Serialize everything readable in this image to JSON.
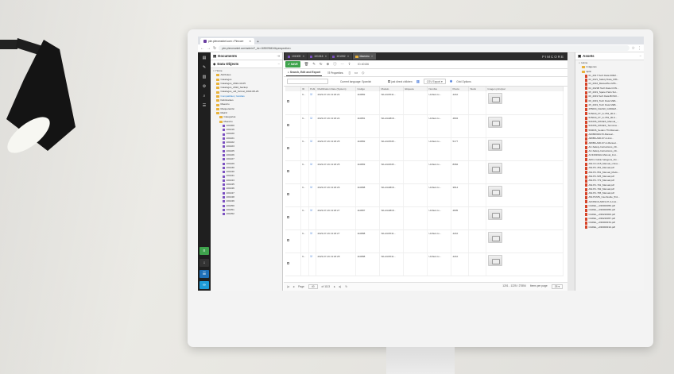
{
  "browser": {
    "tab_title": "pim.pieromarket.com • Pimcore",
    "new_tab": "+",
    "url": "pim.pieromarket.com/admin/?_dc=1690098434&perspective="
  },
  "left_sidebar": {
    "buttons_bottom": [
      "≡",
      "↓",
      "☰",
      "∞"
    ]
  },
  "tree": {
    "documents_label": "Documents",
    "data_objects_label": "Data Objects",
    "rows": [
      {
        "label": "Home",
        "type": "home",
        "level": 0
      },
      {
        "label": "Attributes",
        "type": "folder",
        "level": 1
      },
      {
        "label": "Catalogos",
        "type": "folder",
        "level": 1
      },
      {
        "label": "Catalogos_2022-10-05",
        "type": "folder",
        "level": 1
      },
      {
        "label": "Catalogos_2022_backup",
        "type": "folder",
        "level": 1
      },
      {
        "label": "Catalogos_old_format_2022-08-26",
        "type": "folder",
        "level": 1
      },
      {
        "label": "Compatibles | familias",
        "type": "folder",
        "level": 1,
        "selected": true
      },
      {
        "label": "Fabricantes",
        "type": "folder",
        "level": 1
      },
      {
        "label": "Maestro",
        "type": "folder",
        "level": 1
      },
      {
        "label": "Maquetación",
        "type": "folder",
        "level": 1
      },
      {
        "label": "Matriz",
        "type": "folder",
        "level": 1
      },
      {
        "label": "Categorias",
        "type": "folder",
        "level": 2
      },
      {
        "label": "Maestro",
        "type": "folder",
        "level": 2
      },
      {
        "label": "101000",
        "type": "object",
        "level": 3
      },
      {
        "label": "101016",
        "type": "object",
        "level": 3
      },
      {
        "label": "101020",
        "type": "object",
        "level": 3
      },
      {
        "label": "101021",
        "type": "object",
        "level": 3
      },
      {
        "label": "101022",
        "type": "object",
        "level": 3
      },
      {
        "label": "101023",
        "type": "object",
        "level": 3
      },
      {
        "label": "101025",
        "type": "object",
        "level": 3
      },
      {
        "label": "101026",
        "type": "object",
        "level": 3
      },
      {
        "label": "101027",
        "type": "object",
        "level": 3
      },
      {
        "label": "101029",
        "type": "object",
        "level": 3
      },
      {
        "label": "101030",
        "type": "object",
        "level": 3
      },
      {
        "label": "101040",
        "type": "object",
        "level": 3
      },
      {
        "label": "101041",
        "type": "object",
        "level": 3
      },
      {
        "label": "101043",
        "type": "object",
        "level": 3
      },
      {
        "label": "101045",
        "type": "object",
        "level": 3
      },
      {
        "label": "101046",
        "type": "object",
        "level": 3
      },
      {
        "label": "101047",
        "type": "object",
        "level": 3
      },
      {
        "label": "101048",
        "type": "object",
        "level": 3
      },
      {
        "label": "101049",
        "type": "object",
        "level": 3
      },
      {
        "label": "101050",
        "type": "object",
        "level": 3
      },
      {
        "label": "101051",
        "type": "object",
        "level": 3
      },
      {
        "label": "101052",
        "type": "object",
        "level": 3
      }
    ]
  },
  "editor": {
    "tabs": [
      {
        "label": "101009",
        "active": false
      },
      {
        "label": "101016",
        "active": false
      },
      {
        "label": "101052",
        "active": false
      },
      {
        "label": "Maestro",
        "active": true
      }
    ],
    "brand": "PIMCORE",
    "save_label": "SAVE",
    "id_label": "ID 40136",
    "subtabs": [
      "Search, Edit and Export",
      "Properties"
    ],
    "search_placeholder": "",
    "language_label": "Current language: Spanish",
    "only_children_label": "just direct children",
    "csv_export_label": "CSV Export",
    "grid_options_label": "Grid Options",
    "columns": [
      "ID",
      "Publ.",
      "Modification Date (System)",
      "Codigo",
      "Modelo",
      "Etiqueta",
      "Nombre",
      "Precio",
      "Stock",
      "Imagen principal"
    ],
    "rows": [
      {
        "id": "9...",
        "publ": true,
        "date": "2023-07-19 13:18:24",
        "codigo": "110882",
        "modelo": "SILAIA5X11...",
        "etiqueta": "",
        "nombre": "Unified co...",
        "precio": "4210",
        "stock": ""
      },
      {
        "id": "9...",
        "publ": true,
        "date": "2023-07-19 13:18:24",
        "codigo": "110881",
        "modelo": "SILAIA4818...",
        "etiqueta": "",
        "nombre": "Unified co...",
        "precio": "4834",
        "stock": ""
      },
      {
        "id": "9...",
        "publ": true,
        "date": "2023-07-19 13:18:25",
        "codigo": "110882",
        "modelo": "SILAIA5X25...",
        "etiqueta": "",
        "nombre": "Unified co...",
        "precio": "5177",
        "stock": ""
      },
      {
        "id": "9...",
        "publ": true,
        "date": "2023-07-19 13:18:25",
        "codigo": "110883",
        "modelo": "SILAIA6X25...",
        "etiqueta": "",
        "nombre": "Unified co...",
        "precio": "8084",
        "stock": ""
      },
      {
        "id": "9...",
        "publ": true,
        "date": "2023-07-19 13:18:26",
        "codigo": "110888",
        "modelo": "SILAIA4818...",
        "etiqueta": "",
        "nombre": "Unified co...",
        "precio": "3814",
        "stock": ""
      },
      {
        "id": "9...",
        "publ": true,
        "date": "2023-07-19 13:18:27",
        "codigo": "110887",
        "modelo": "SILAIA4818...",
        "etiqueta": "",
        "nombre": "Unified co...",
        "precio": "4835",
        "stock": ""
      },
      {
        "id": "9...",
        "publ": true,
        "date": "2023-07-19 13:18:27",
        "codigo": "110888",
        "modelo": "SILAIA5X11...",
        "etiqueta": "",
        "nombre": "Unified co...",
        "precio": "4210",
        "stock": ""
      },
      {
        "id": "9...",
        "publ": true,
        "date": "2023-07-19 13:18:28",
        "codigo": "110888",
        "modelo": "SILAIA5X11...",
        "etiqueta": "",
        "nombre": "Unified co...",
        "precio": "4210",
        "stock": ""
      }
    ],
    "pager": {
      "page_label": "Page",
      "page_value": "40",
      "of_label": "of 1113",
      "range": "1201 - 1225 / 27854",
      "items_label": "Items per page",
      "items_value": "25"
    }
  },
  "assets": {
    "title": "Assets",
    "rows": [
      {
        "label": "Home",
        "type": "home",
        "level": 0
      },
      {
        "label": "Imágenes",
        "type": "folder",
        "level": 1
      },
      {
        "label": "Aplic",
        "type": "folder",
        "level": 1
      },
      {
        "label": "01_2017 Tech Data 003M...",
        "type": "pdf",
        "level": 2
      },
      {
        "label": "02_2021_Safety Data_MIS...",
        "type": "pdf",
        "level": 2
      },
      {
        "label": "03_2016_ManualTec-MIS...",
        "type": "pdf",
        "level": 2
      },
      {
        "label": "04_2021B Tech Data CON...",
        "type": "pdf",
        "level": 2
      },
      {
        "label": "05_2019_Spare Parts SH...",
        "type": "pdf",
        "level": 2
      },
      {
        "label": "06_2019 Tech Data BOSO...",
        "type": "pdf",
        "level": 2
      },
      {
        "label": "09_2019_Tech Data ME6...",
        "type": "pdf",
        "level": 2
      },
      {
        "label": "25_2019_Tech Data ME8...",
        "type": "pdf",
        "level": 2
      },
      {
        "label": "255004_FHAS0_GODEM...",
        "type": "pdf",
        "level": 2
      },
      {
        "label": "515044_FT_G-V53_00-0...",
        "type": "pdf",
        "level": 2
      },
      {
        "label": "515044_FT_G-V53_00-0...",
        "type": "pdf",
        "level": 2
      },
      {
        "label": "521066_MXAES_Manual_...",
        "type": "pdf",
        "level": 2
      },
      {
        "label": "521066_MXAES_Tecnicos...",
        "type": "pdf",
        "level": 2
      },
      {
        "label": "590036_Sedan-770-Manual...",
        "type": "pdf",
        "level": 2
      },
      {
        "label": "A0080004G70-Manual...",
        "type": "pdf",
        "level": 2
      },
      {
        "label": "A80B9-A3D-07-A-Inst...",
        "type": "pdf",
        "level": 2
      },
      {
        "label": "A80B9-A3D-07-A-Manual...",
        "type": "pdf",
        "level": 2
      },
      {
        "label": "AC-Safety-Instructions_20...",
        "type": "pdf",
        "level": 2
      },
      {
        "label": "AC-Safety-Instructions_20...",
        "type": "pdf",
        "level": 2
      },
      {
        "label": "AC34020HH-Manual_Inst...",
        "type": "pdf",
        "level": 2
      },
      {
        "label": "ARCL Cable halogens_Fin...",
        "type": "pdf",
        "level": 2
      },
      {
        "label": "AW-CC-215_Manual_Unive...",
        "type": "pdf",
        "level": 2
      },
      {
        "label": "AW-PC-451_Manual.pdf",
        "type": "pdf",
        "level": 2
      },
      {
        "label": "AW-PC-551_Manual_Modu...",
        "type": "pdf",
        "level": 2
      },
      {
        "label": "AW-PC-525_Manual.pdf",
        "type": "pdf",
        "level": 2
      },
      {
        "label": "AW-PC-772_Manual.pdf",
        "type": "pdf",
        "level": 2
      },
      {
        "label": "AW-PC-791_Manual.pdf",
        "type": "pdf",
        "level": 2
      },
      {
        "label": "AW-PC-792_Manual.pdf",
        "type": "pdf",
        "level": 2
      },
      {
        "label": "AW-PC-765_Manual.pdf",
        "type": "pdf",
        "level": 2
      },
      {
        "label": "AW-PUMS_UserGuide_511...",
        "type": "pdf",
        "level": 2
      },
      {
        "label": "AZCB416-A0D3-07-A-Inst...",
        "type": "pdf",
        "level": 2
      },
      {
        "label": "CAREL_+030000056.pdf",
        "type": "pdf",
        "level": 2
      },
      {
        "label": "CAREL_+030000056.pdf",
        "type": "pdf",
        "level": 2
      },
      {
        "label": "CAREL_+030220000.pdf",
        "type": "pdf",
        "level": 2
      },
      {
        "label": "CAREL_+030220057.pdf",
        "type": "pdf",
        "level": 2
      },
      {
        "label": "CAREL_+030000154.pdf",
        "type": "pdf",
        "level": 2
      },
      {
        "label": "CAREL_+030000194.pdf",
        "type": "pdf",
        "level": 2
      }
    ]
  },
  "colors": {
    "save": "#3fa34d",
    "accent": "#7a4fc0",
    "pdf": "#d6452a",
    "folder": "#e8b23a"
  }
}
